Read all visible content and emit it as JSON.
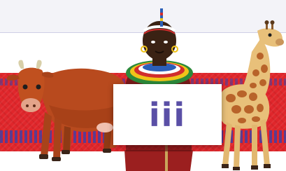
{
  "card": {
    "text": "iii",
    "text_color": "#5a4fa6"
  },
  "scene": {
    "background_color": "#e0262b",
    "stripe_color": "#3b3fa8",
    "characters": [
      "cow-illustration",
      "maasai-person-illustration",
      "giraffe-illustration"
    ]
  }
}
